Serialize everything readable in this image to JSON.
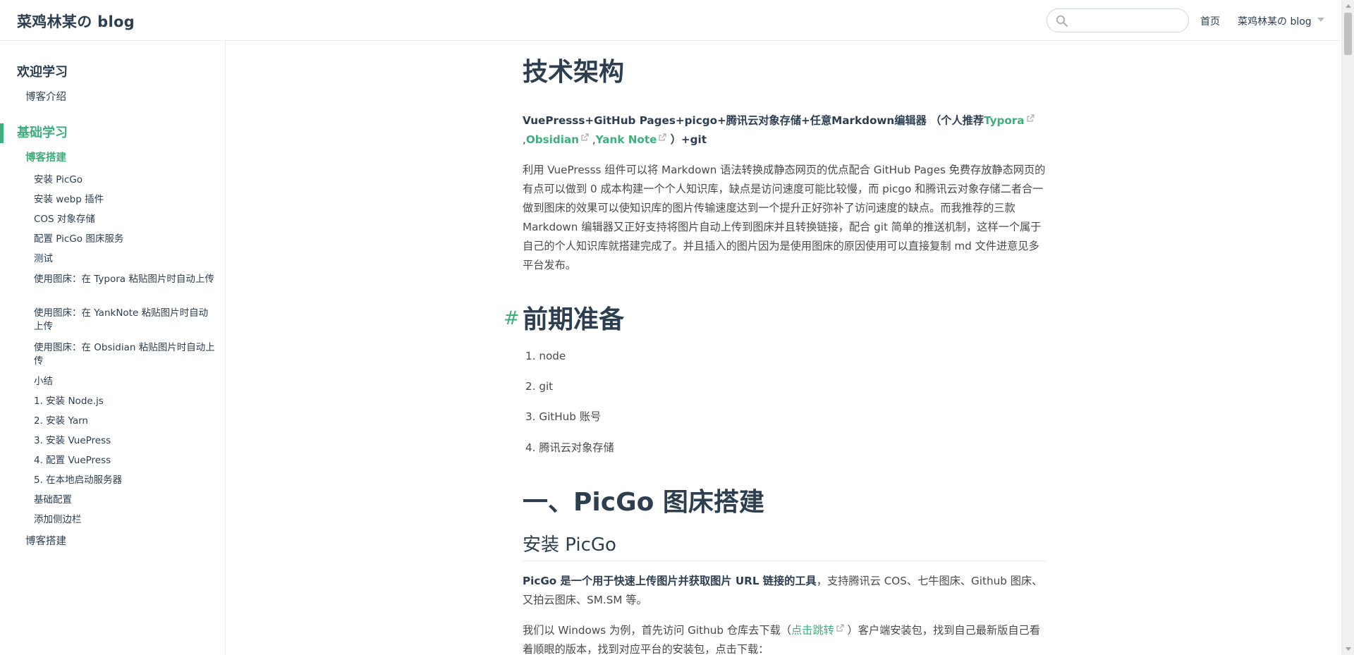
{
  "navbar": {
    "site_name": "菜鸡林某の blog",
    "search_placeholder": "",
    "home_label": "首页",
    "dropdown_label": "菜鸡林某の blog"
  },
  "sidebar": {
    "groups": [
      {
        "label": "欢迎学习",
        "active": false
      },
      {
        "label": "基础学习",
        "active": true
      }
    ],
    "intro_item": "博客介绍",
    "active_item": "博客搭建",
    "sub_items": [
      "安装 PicGo",
      "安装 webp 插件",
      "COS 对象存储",
      "配置 PicGo 图床服务",
      "测试",
      "使用图床：在 Typora 粘贴图片时自动上传",
      "使用图床：在 YankNote 粘贴图片时自动上传",
      "使用图床：在 Obsidian 粘贴图片时自动上传",
      "小结",
      "1. 安装 Node.js",
      "2. 安装 Yarn",
      "3. 安装 VuePress",
      "4. 配置 VuePress",
      "5. 在本地启动服务器",
      "基础配置",
      "添加侧边栏"
    ],
    "last_item": "博客搭建"
  },
  "content": {
    "title": "技术架构",
    "stack": {
      "prefix": "VuePresss+GitHub Pages+picgo+腾讯云对象存储+任意Markdown编辑器 （个人推荐",
      "link1": "Typora",
      "sep1": ",",
      "link2": "Obsidian",
      "sep2": " ,",
      "link3": "Yank Note",
      "suffix": " ）+git"
    },
    "intro_paragraph": "利用 VuePresss 组件可以将 Markdown 语法转换成静态网页的优点配合 GitHub Pages 免费存放静态网页的有点可以做到 0 成本构建一个个人知识库，缺点是访问速度可能比较慢，而 picgo 和腾讯云对象存储二者合一做到图床的效果可以使知识库的图片传输速度达到一个提升正好弥补了访问速度的缺点。而我推荐的三款 Markdown 编辑器又正好支持将图片自动上传到图床并且转换链接，配合 git 简单的推送机制，这样一个属于自己的个人知识库就搭建完成了。并且插入的图片因为是使用图床的原因使用可以直接复制 md 文件进意见多平台发布。",
    "prep_anchor": "#",
    "prep_heading": "前期准备",
    "prep_list": [
      "1. node",
      "2. git",
      "3. GitHub 账号",
      "4. 腾讯云对象存储"
    ],
    "section_heading": "一、PicGo 图床搭建",
    "sub_heading": "安装 PicGo",
    "picgo_bold": "PicGo 是一个用于快速上传图片并获取图片 URL 链接的工具",
    "picgo_rest": "，支持腾讯云 COS、七牛图床、Github 图床、又拍云图床、SM.SM 等。",
    "download_prefix": "我们以 Windows 为例，首先访问 Github 仓库去下载（",
    "download_link": "点击跳转",
    "download_suffix": " ）客户端安装包，找到自己最新版自己看着顺眼的版本，找到对应平台的安装包，点击下载："
  },
  "colors": {
    "accent": "#3eaf7c",
    "text": "#2c3e50",
    "body_text": "#4a4a4a",
    "border": "#eaecef"
  },
  "icons": {
    "search": "search-icon",
    "external_link": "external-link-icon",
    "dropdown_caret": "chevron-down-icon"
  }
}
